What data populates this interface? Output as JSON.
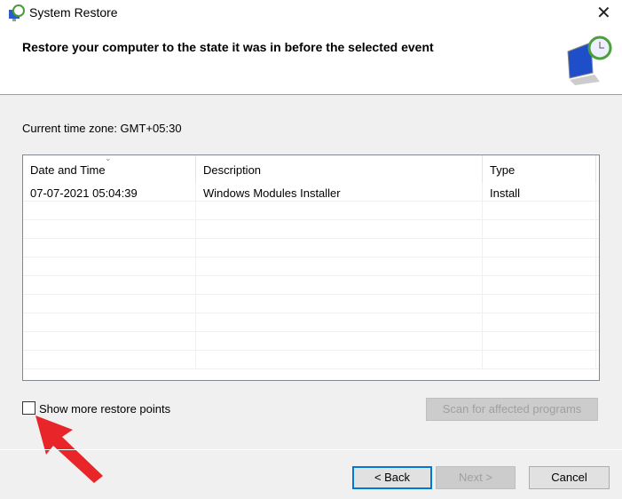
{
  "window": {
    "title": "System Restore",
    "close_icon": "close-icon"
  },
  "header": {
    "heading": "Restore your computer to the state it was in before the selected event"
  },
  "timezone": "Current time zone: GMT+05:30",
  "table": {
    "columns": [
      "Date and Time",
      "Description",
      "Type"
    ],
    "rows": [
      {
        "date": "07-07-2021 05:04:39",
        "description": "Windows Modules Installer",
        "type": "Install"
      }
    ]
  },
  "options": {
    "show_more_label": "Show more restore points",
    "show_more_checked": false,
    "scan_label": "Scan for affected programs"
  },
  "footer": {
    "back": "< Back",
    "next": "Next >",
    "cancel": "Cancel"
  },
  "colors": {
    "annotation_arrow": "#e8262a",
    "focus": "#0078d7"
  }
}
